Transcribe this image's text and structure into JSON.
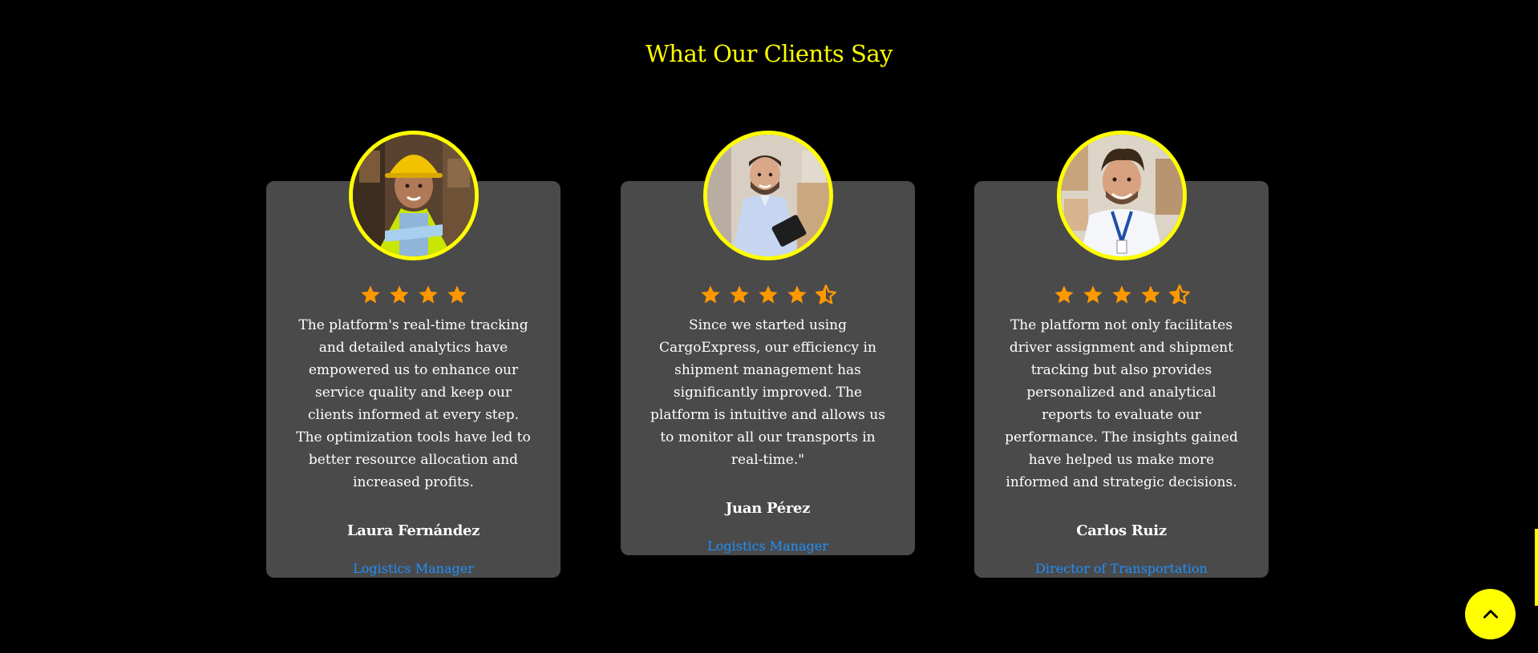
{
  "section": {
    "title": "What Our Clients Say"
  },
  "colors": {
    "background": "#000000",
    "title": "#ffff00",
    "card": "#4a4a4a",
    "avatar_border": "#ffff00",
    "star": "#ff9800",
    "role": "#1e90ff",
    "scroll_button": "#ffff00"
  },
  "testimonials": [
    {
      "quote": "The platform's real-time tracking and detailed analytics have empowered us to enhance our service quality and keep our clients informed at every step. The optimization tools have led to better resource allocation and increased profits.",
      "name": "Laura Fernández",
      "role": "Logistics Manager",
      "rating": 4,
      "avatar_icon": "woman-hard-hat-avatar"
    },
    {
      "quote": "Since we started using CargoExpress, our efficiency in shipment management has significantly improved. The platform is intuitive and allows us to monitor all our transports in real-time.\"",
      "name": "Juan Pérez",
      "role": "Logistics Manager",
      "rating": 4.5,
      "avatar_icon": "man-clipboard-avatar"
    },
    {
      "quote": "The platform not only facilitates driver assignment and shipment tracking but also provides personalized and analytical reports to evaluate our performance. The insights gained have helped us make more informed and strategic decisions.",
      "name": "Carlos Ruiz",
      "role": "Director of Transportation",
      "rating": 4.5,
      "avatar_icon": "man-lanyard-avatar"
    }
  ],
  "scroll_top": {
    "icon": "chevron-up-icon"
  }
}
